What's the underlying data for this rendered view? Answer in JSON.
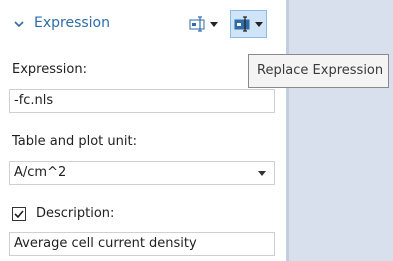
{
  "section": {
    "title": "Expression",
    "insert_icon": "insert-expression-icon",
    "replace_icon": "replace-expression-icon"
  },
  "tooltip": {
    "text": "Replace Expression"
  },
  "expression": {
    "label": "Expression:",
    "value": "-fc.nls"
  },
  "unit": {
    "label": "Table and plot unit:",
    "value": "A/cm^2"
  },
  "description": {
    "label": "Description:",
    "checked": true,
    "value": "Average cell current density"
  },
  "colors": {
    "header_text": "#2f6ca8",
    "active_button_bg": "#cfe4f7",
    "background_right": "#d7e0ec"
  }
}
